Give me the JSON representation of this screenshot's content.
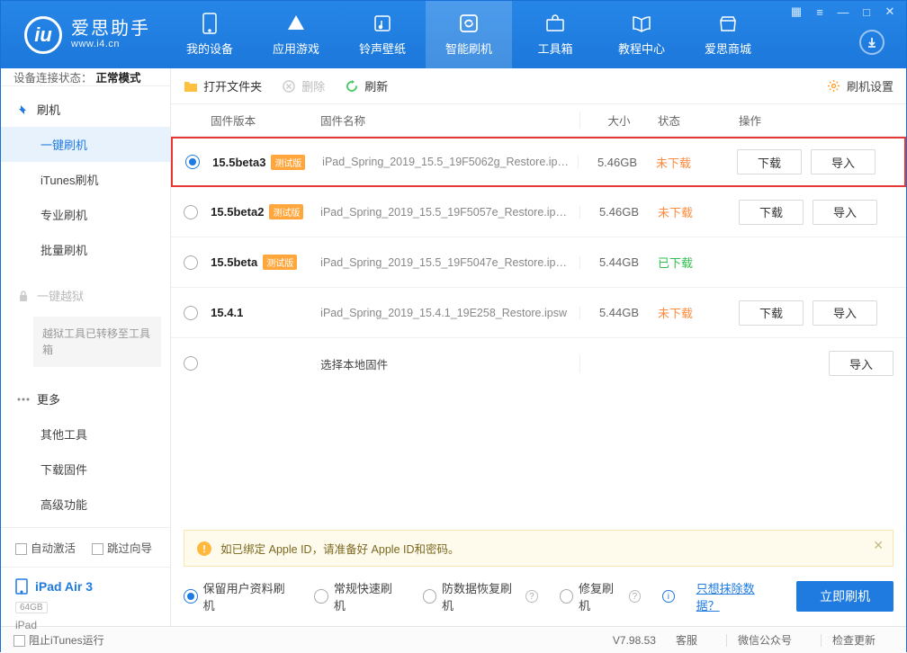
{
  "header": {
    "logo_glyph": "iu",
    "app_name": "爱思助手",
    "app_url": "www.i4.cn",
    "nav": [
      {
        "label": "我的设备"
      },
      {
        "label": "应用游戏"
      },
      {
        "label": "铃声壁纸"
      },
      {
        "label": "智能刷机"
      },
      {
        "label": "工具箱"
      },
      {
        "label": "教程中心"
      },
      {
        "label": "爱思商城"
      }
    ]
  },
  "sidebar": {
    "status_label": "设备连接状态：",
    "status_value": "正常模式",
    "flash_group": {
      "title": "刷机",
      "items": [
        "一键刷机",
        "iTunes刷机",
        "专业刷机",
        "批量刷机"
      ]
    },
    "jailbreak_title": "一键越狱",
    "jailbreak_note": "越狱工具已转移至工具箱",
    "more_group": {
      "title": "更多",
      "items": [
        "其他工具",
        "下载固件",
        "高级功能"
      ]
    },
    "auto_activate": "自动激活",
    "skip_guide": "跳过向导",
    "device": {
      "name": "iPad Air 3",
      "capacity": "64GB",
      "type": "iPad"
    }
  },
  "toolbar": {
    "open_folder": "打开文件夹",
    "delete": "删除",
    "refresh": "刷新",
    "settings": "刷机设置"
  },
  "table": {
    "headers": {
      "version": "固件版本",
      "name": "固件名称",
      "size": "大小",
      "status": "状态",
      "ops": "操作"
    },
    "beta_tag": "测试版",
    "btn_download": "下载",
    "btn_import": "导入",
    "select_local": "选择本地固件",
    "rows": [
      {
        "version": "15.5beta3",
        "beta": true,
        "name": "iPad_Spring_2019_15.5_19F5062g_Restore.ip…",
        "size": "5.46GB",
        "status": "未下载",
        "status_kind": "need",
        "dl": true,
        "imp": true,
        "selected": true,
        "hl": true
      },
      {
        "version": "15.5beta2",
        "beta": true,
        "name": "iPad_Spring_2019_15.5_19F5057e_Restore.ip…",
        "size": "5.46GB",
        "status": "未下载",
        "status_kind": "need",
        "dl": true,
        "imp": true
      },
      {
        "version": "15.5beta",
        "beta": true,
        "name": "iPad_Spring_2019_15.5_19F5047e_Restore.ip…",
        "size": "5.44GB",
        "status": "已下载",
        "status_kind": "done"
      },
      {
        "version": "15.4.1",
        "beta": false,
        "name": "iPad_Spring_2019_15.4.1_19E258_Restore.ipsw",
        "size": "5.44GB",
        "status": "未下载",
        "status_kind": "need",
        "dl": true,
        "imp": true
      }
    ]
  },
  "notice": "如已绑定 Apple ID，请准备好 Apple ID和密码。",
  "flash_opts": {
    "keep_data": "保留用户资料刷机",
    "normal": "常规快速刷机",
    "anti_data": "防数据恢复刷机",
    "repair": "修复刷机",
    "erase_link": "只想抹除数据？",
    "go": "立即刷机"
  },
  "bottom": {
    "stop_itunes": "阻止iTunes运行",
    "version": "V7.98.53",
    "service": "客服",
    "wechat": "微信公众号",
    "update": "检查更新"
  }
}
